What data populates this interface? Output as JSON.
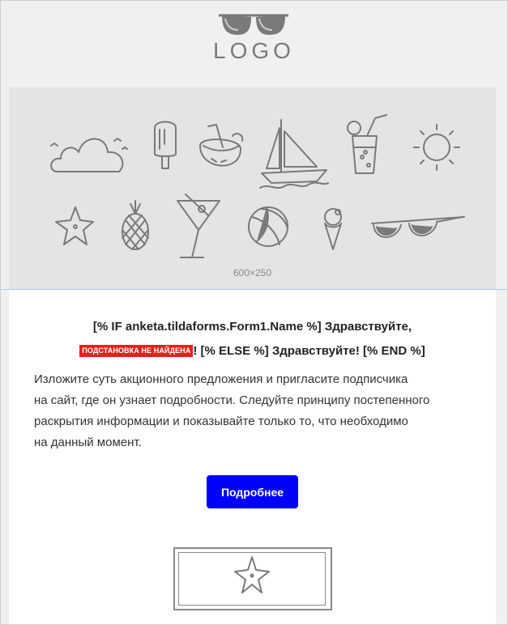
{
  "header": {
    "logo_text": "LOGO",
    "logo_icon": "sunglasses-icon"
  },
  "banner": {
    "size_label": "600×250",
    "icons": [
      "cloud-icon",
      "popsicle-icon",
      "coconut-drink-icon",
      "sailboat-icon",
      "cocktail-glass-icon",
      "sun-icon",
      "starfish-icon",
      "pineapple-icon",
      "martini-icon",
      "beach-ball-icon",
      "ice-cream-icon",
      "sunglasses-icon"
    ]
  },
  "greeting": {
    "line1": "[% IF anketa.tildaforms.Form1.Name %] Здравствуйте,",
    "badge": "ПОДСТАНОВКА НЕ НАЙДЕНА",
    "line2": "! [% ELSE %] Здравствуйте! [% END %]"
  },
  "body_text": {
    "line1": "Изложите суть акционного предложения и пригласите подписчика",
    "line2": "на сайт, где он узнает подробности. Следуйте принципу постепенного",
    "line3": "раскрытия информации и показывайте только то, что необходимо",
    "line4": "на данный момент."
  },
  "cta": {
    "label": "Подробнее"
  },
  "colors": {
    "page_bg": "#f0f0f0",
    "banner_bg": "#e4e4e4",
    "button_bg": "#0000ff",
    "badge_bg": "#e8201c",
    "icon_stroke": "#7a7a7a"
  },
  "card": {
    "icon": "starfish-icon"
  }
}
